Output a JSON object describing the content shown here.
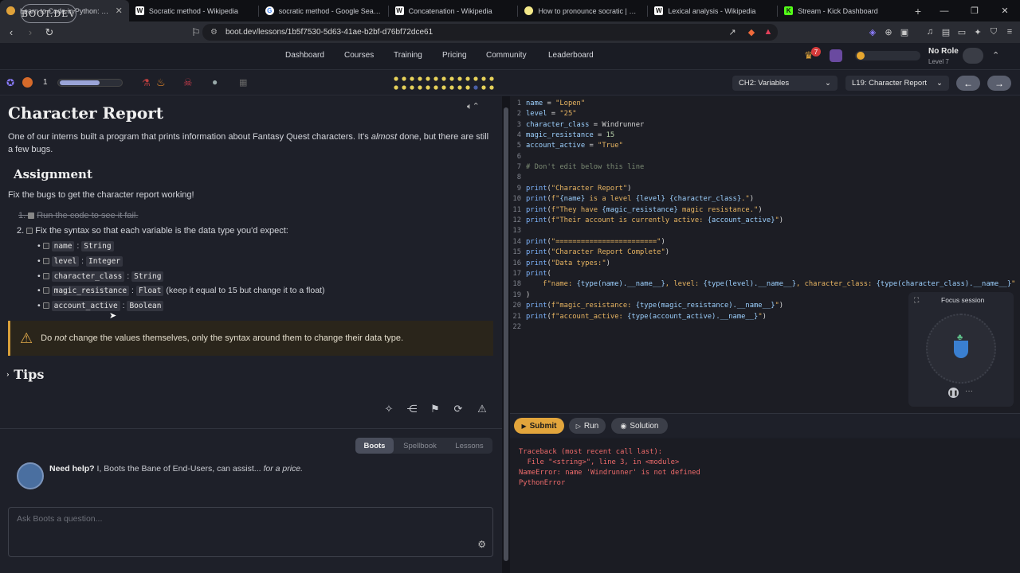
{
  "browser": {
    "tabs": [
      {
        "title": "Learn to Code in Python: Chara",
        "icon": "bootdev-favicon",
        "color": "#e0a23a",
        "active": true
      },
      {
        "title": "Socratic method - Wikipedia",
        "icon": "wikipedia-favicon",
        "color": "#ffffff"
      },
      {
        "title": "socratic method - Google Search",
        "icon": "google-favicon",
        "color": "#ffffff"
      },
      {
        "title": "Concatenation - Wikipedia",
        "icon": "wikipedia-favicon",
        "color": "#ffffff"
      },
      {
        "title": "How to pronounce socratic | HowToP",
        "icon": "howtopronounce-favicon",
        "color": "#f3e889"
      },
      {
        "title": "Lexical analysis - Wikipedia",
        "icon": "wikipedia-favicon",
        "color": "#ffffff"
      },
      {
        "title": "Stream - Kick Dashboard",
        "icon": "kick-favicon",
        "color": "#53fc18"
      }
    ],
    "url": "boot.dev/lessons/1b5f7530-5d63-41ae-b2bf-d76bf72dce61"
  },
  "site": {
    "logo": "BOOT.DEV",
    "nav": [
      "Dashboard",
      "Courses",
      "Training",
      "Pricing",
      "Community",
      "Leaderboard"
    ],
    "notifications": "7",
    "role": "No Role",
    "level": "Level 7",
    "streak": "1"
  },
  "lesson_bar": {
    "chapter": "CH2: Variables",
    "lesson": "L19: Character Report"
  },
  "lesson": {
    "title": "Character Report",
    "intro_a": "One of our interns built a program that prints information about Fantasy Quest characters. It's ",
    "intro_em": "almost",
    "intro_b": " done, but there are still a few bugs.",
    "assignment_heading": "Assignment",
    "assignment_text": "Fix the bugs to get the character report working!",
    "steps": [
      "Run the code to see it fail.",
      "Fix the syntax so that each variable is the data type you'd expect:"
    ],
    "vars": [
      {
        "name": "name",
        "type": "String",
        "note": ""
      },
      {
        "name": "level",
        "type": "Integer",
        "note": ""
      },
      {
        "name": "character_class",
        "type": "String",
        "note": ""
      },
      {
        "name": "magic_resistance",
        "type": "Float",
        "note": "(keep it equal to 15 but change it to a float)"
      },
      {
        "name": "account_active",
        "type": "Boolean",
        "note": ""
      }
    ],
    "warning_a": "Do ",
    "warning_em": "not",
    "warning_b": " change the values themselves, only the syntax around them to change their data type.",
    "tips": "Tips"
  },
  "chat": {
    "tabs": [
      "Boots",
      "Spellbook",
      "Lessons"
    ],
    "need_help": "Need help?",
    "help_text": " I, Boots the Bane of End-Users, can assist... ",
    "help_em": "for a price.",
    "placeholder": "Ask Boots a question..."
  },
  "editor": {
    "line_numbers": [
      "1",
      "2",
      "3",
      "4",
      "5",
      "6",
      "7",
      "8",
      "9",
      "10",
      "11",
      "12",
      "13",
      "14",
      "15",
      "16",
      "17",
      "18",
      "19",
      "20",
      "21",
      "22"
    ]
  },
  "focus": {
    "title": "Focus session"
  },
  "buttons": {
    "submit": "Submit",
    "run": "Run",
    "solution": "Solution"
  },
  "console": {
    "lines": [
      "Traceback (most recent call last):",
      "  File \"<string>\", line 3, in <module>",
      "NameError: name 'Windrunner' is not defined",
      "PythonError"
    ]
  }
}
